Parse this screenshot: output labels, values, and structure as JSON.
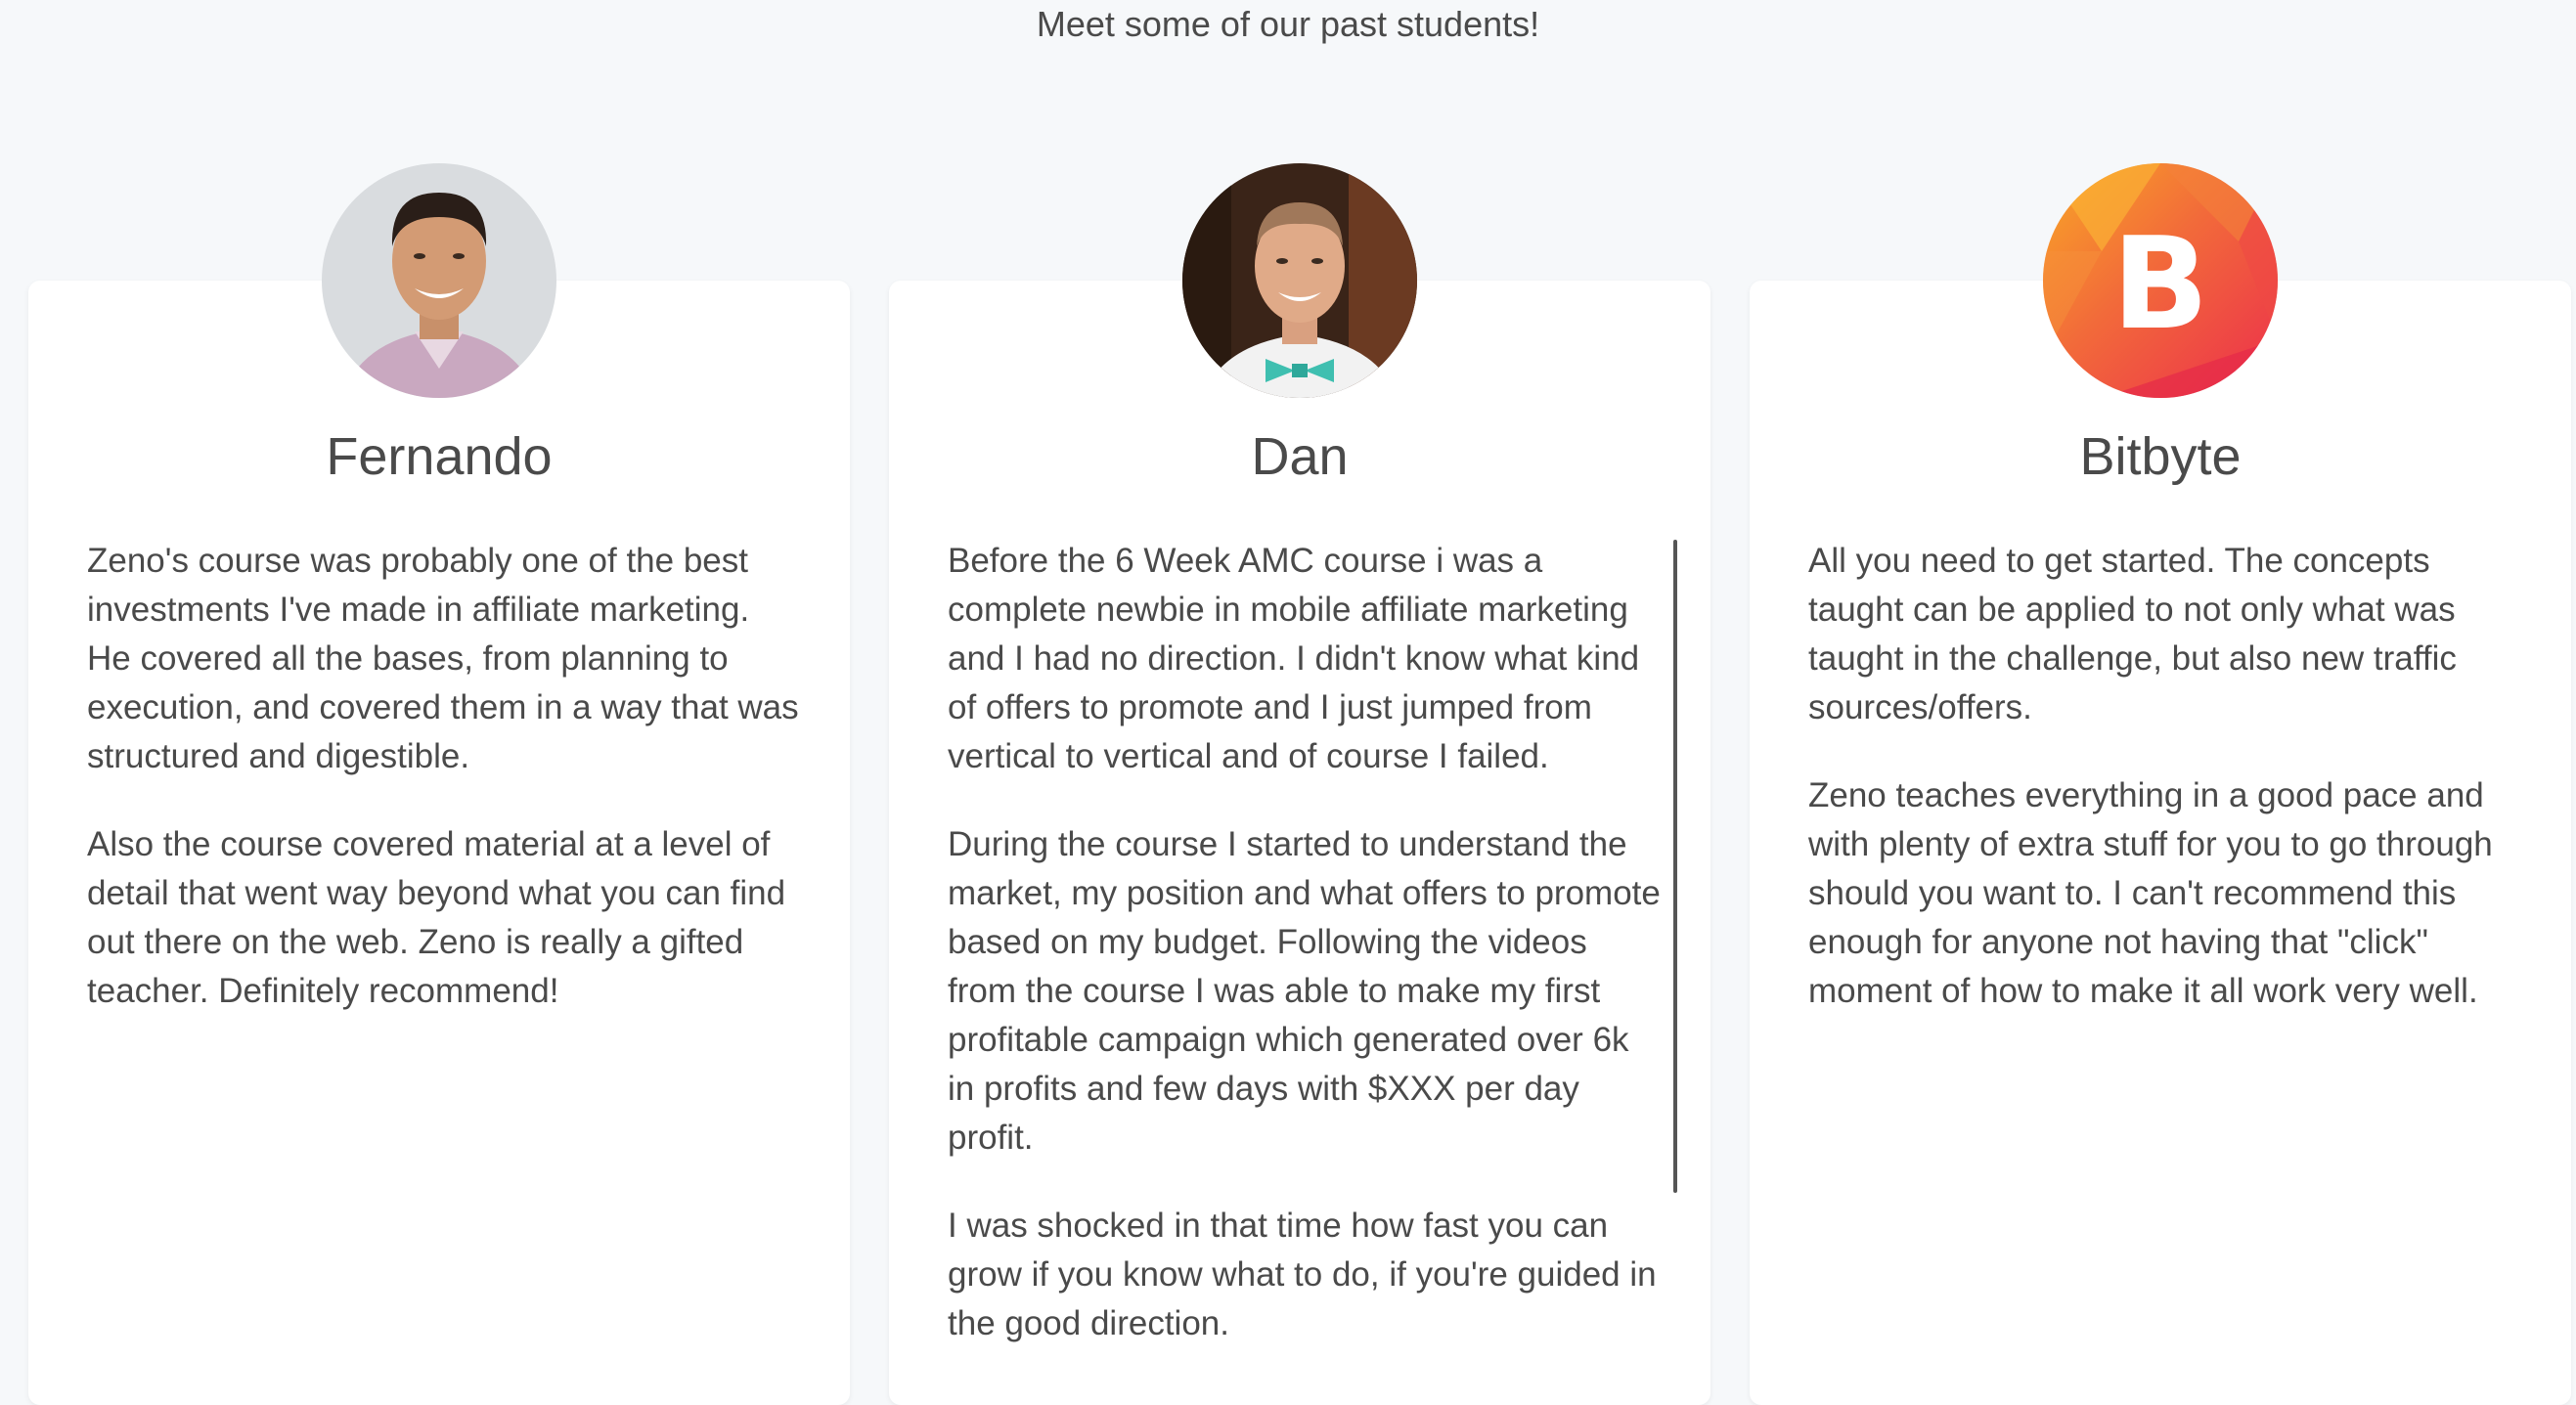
{
  "section": {
    "heading": "Meet some of our past students!"
  },
  "testimonials": [
    {
      "name": "Fernando",
      "avatar_icon": "person-photo-icon",
      "paragraphs": [
        "Zeno's course was probably one of the best investments I've made in affiliate marketing. He covered all the bases, from planning to execution, and covered them in a way that was structured and digestible.",
        "Also the course covered material at a level of detail that went way beyond what you can find out there on the web. Zeno is really a gifted teacher. Definitely recommend!"
      ]
    },
    {
      "name": "Dan",
      "avatar_icon": "person-photo-icon",
      "paragraphs": [
        "Before the 6 Week AMC course i was a complete newbie in mobile affiliate marketing and I had no direction. I didn't know what kind of offers to promote and I just jumped from vertical to vertical and of course I failed.",
        "During the course I started to understand the market, my position and what offers to promote based on my budget. Following the videos from the course I was able to make my first profitable campaign which generated over 6k in profits and few days with $XXX per day profit.",
        "I was shocked in that time how fast you can grow if you know what to do, if you're guided in the good direction."
      ]
    },
    {
      "name": "Bitbyte",
      "avatar_icon": "bitbyte-logo-icon",
      "avatar_letter": "B",
      "paragraphs": [
        "All you need to get started. The concepts taught can be applied to not only what was taught in the challenge, but also new traffic sources/offers.",
        "Zeno teaches everything in a good pace and with plenty of extra stuff for you to go through should you want to. I can't recommend this enough for anyone not having that \"click\" moment of how to make it all work very well."
      ]
    }
  ],
  "colors": {
    "background": "#f6f8fa",
    "card": "#ffffff",
    "text": "#4a4a4a",
    "logo_orange": "#f7931e",
    "logo_red": "#ef3b4f"
  }
}
